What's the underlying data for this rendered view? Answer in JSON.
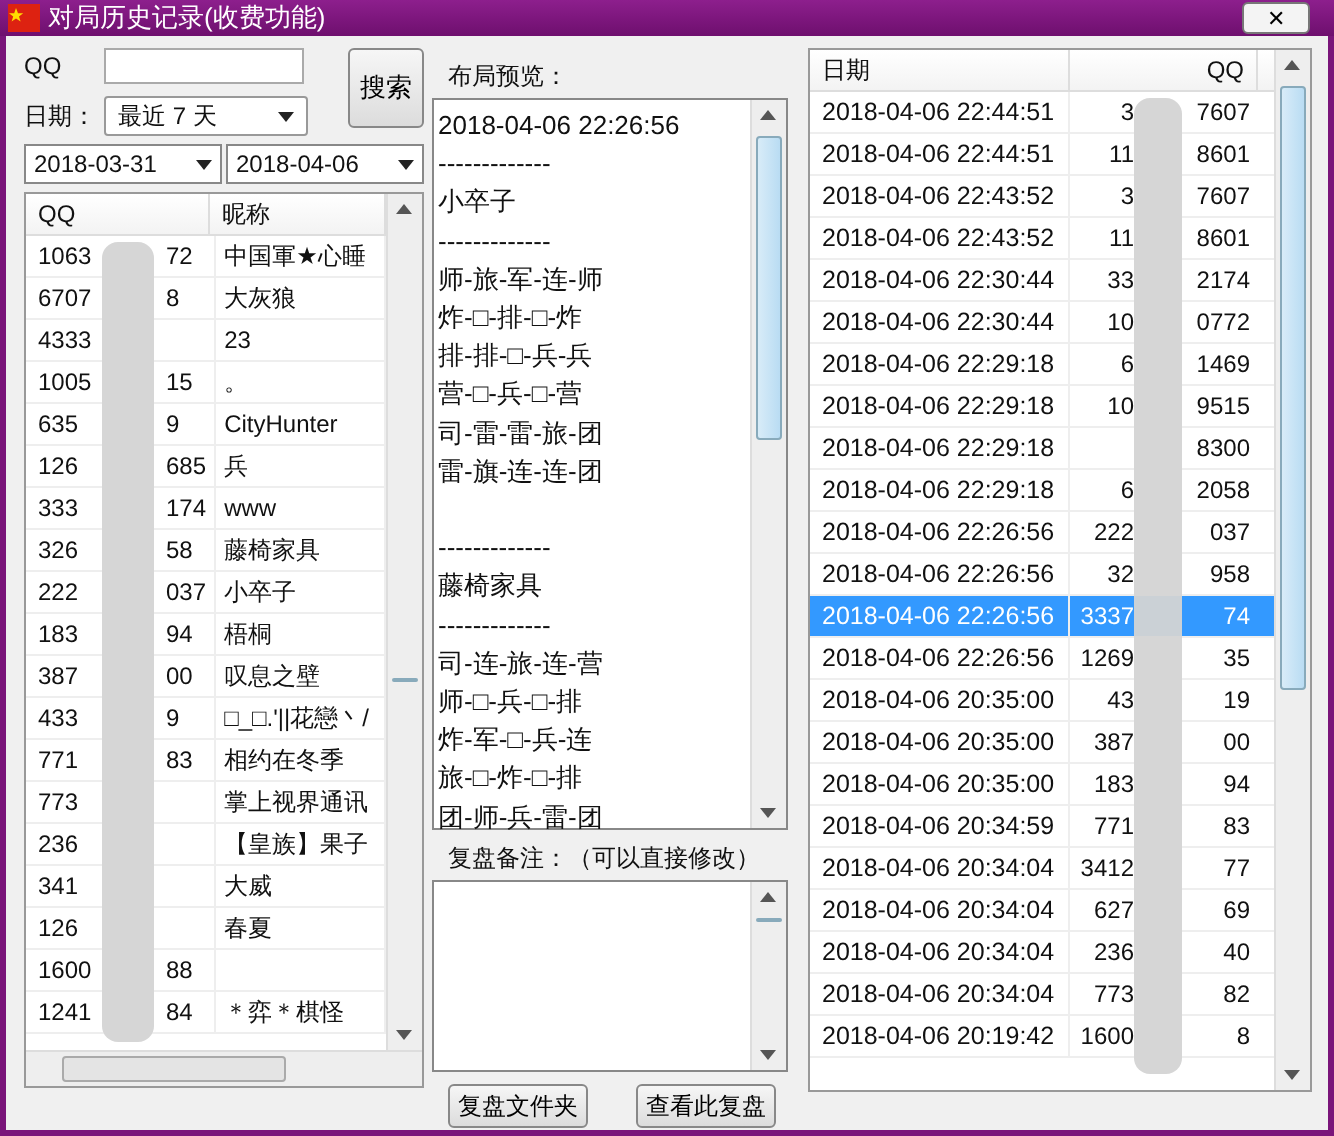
{
  "window": {
    "title": "对局历史记录(收费功能)",
    "close": "✕"
  },
  "search": {
    "qq_label": "QQ",
    "date_label": "日期：",
    "date_range": "最近 7 天",
    "start_date": "2018-03-31",
    "end_date": "2018-04-06",
    "button": "搜索"
  },
  "players": {
    "columns": [
      "QQ",
      "昵称"
    ],
    "rows": [
      {
        "qq_start": "1063",
        "qq_end": "72",
        "nickname": "中国軍★心睡"
      },
      {
        "qq_start": "6707",
        "qq_end": "8",
        "nickname": "大灰狼"
      },
      {
        "qq_start": "4333",
        "nickname": "23"
      },
      {
        "qq_start": "1005",
        "qq_end": "15",
        "nickname": "。"
      },
      {
        "qq_start": "635",
        "qq_end": "9",
        "nickname": "CityHunter"
      },
      {
        "qq_start": "126",
        "qq_end": "685",
        "nickname": "兵"
      },
      {
        "qq_start": "333",
        "qq_end": "174",
        "nickname": "www"
      },
      {
        "qq_start": "326",
        "qq_end": "58",
        "nickname": "藤椅家具"
      },
      {
        "qq_start": "222",
        "qq_end": "037",
        "nickname": "小卒子"
      },
      {
        "qq_start": "183",
        "qq_end": "94",
        "nickname": "梧桐"
      },
      {
        "qq_start": "387",
        "qq_end": "00",
        "nickname": "叹息之壁"
      },
      {
        "qq_start": "433",
        "qq_end": "9",
        "nickname": "□_□.'||花戀丶/"
      },
      {
        "qq_start": "771",
        "qq_end": "83",
        "nickname": "相约在冬季"
      },
      {
        "qq_start": "773",
        "nickname": "掌上视界通讯"
      },
      {
        "qq_start": "236",
        "nickname": "【皇族】果子"
      },
      {
        "qq_start": "341",
        "nickname": "大威"
      },
      {
        "qq_start": "126",
        "nickname": "春夏"
      },
      {
        "qq_start": "1600",
        "qq_end": "88"
      },
      {
        "qq_start": "1241",
        "qq_end": "84",
        "nickname": "＊弈＊棋怪"
      }
    ]
  },
  "preview": {
    "label": "布局预览：",
    "lines": [
      {
        "text": "2018-04-06 22:26:56",
        "gap_before": false
      },
      {
        "text": "-------------",
        "gap_before": false
      },
      {
        "text": "小卒子",
        "gap_before": false
      },
      {
        "text": "-------------",
        "gap_before": false
      },
      {
        "text": "师-旅-军-连-师",
        "gap_before": false
      },
      {
        "text": "炸-□-排-□-炸",
        "gap_before": false
      },
      {
        "text": "排-排-□-兵-兵",
        "gap_before": false
      },
      {
        "text": "营-□-兵-□-营",
        "gap_before": false
      },
      {
        "text": "司-雷-雷-旅-团",
        "gap_before": false
      },
      {
        "text": "雷-旗-连-连-团",
        "gap_before": false
      },
      {
        "text": "-------------",
        "gap_before": true
      },
      {
        "text": "藤椅家具",
        "gap_before": false
      },
      {
        "text": "-------------",
        "gap_before": false
      },
      {
        "text": "司-连-旅-连-营",
        "gap_before": false
      },
      {
        "text": "师-□-兵-□-排",
        "gap_before": false
      },
      {
        "text": "炸-军-□-兵-连",
        "gap_before": false
      },
      {
        "text": "旅-□-炸-□-排",
        "gap_before": false
      },
      {
        "text": "团-师-兵-雷-团",
        "gap_before": false
      }
    ]
  },
  "notes": {
    "label": "复盘备注：（可以直接修改）"
  },
  "buttons": [
    "复盘文件夹",
    "查看此复盘"
  ],
  "games": {
    "columns": [
      "日期",
      "QQ"
    ],
    "rows": [
      {
        "date": "2018-04-06 22:44:51",
        "qq_start": "3",
        "qq_end": "7607",
        "selected": false
      },
      {
        "date": "2018-04-06 22:44:51",
        "qq_start": "11",
        "qq_end": "8601",
        "selected": false
      },
      {
        "date": "2018-04-06 22:43:52",
        "qq_start": "3",
        "qq_end": "7607",
        "selected": false
      },
      {
        "date": "2018-04-06 22:43:52",
        "qq_start": "11",
        "qq_end": "8601",
        "selected": false
      },
      {
        "date": "2018-04-06 22:30:44",
        "qq_start": "33",
        "qq_end": "2174",
        "selected": false
      },
      {
        "date": "2018-04-06 22:30:44",
        "qq_start": "10",
        "qq_end": "0772",
        "selected": false
      },
      {
        "date": "2018-04-06 22:29:18",
        "qq_start": "6",
        "qq_end": "1469",
        "selected": false
      },
      {
        "date": "2018-04-06 22:29:18",
        "qq_start": "10",
        "qq_end": "9515",
        "selected": false
      },
      {
        "date": "2018-04-06 22:29:18",
        "qq_end": "8300",
        "selected": false
      },
      {
        "date": "2018-04-06 22:29:18",
        "qq_start": "6",
        "qq_end": "2058",
        "selected": false
      },
      {
        "date": "2018-04-06 22:26:56",
        "qq_start": "222",
        "qq_end": "037",
        "selected": false
      },
      {
        "date": "2018-04-06 22:26:56",
        "qq_start": "32",
        "qq_end": "958",
        "selected": false
      },
      {
        "date": "2018-04-06 22:26:56",
        "qq_start": "3337",
        "qq_end": "74",
        "selected": true
      },
      {
        "date": "2018-04-06 22:26:56",
        "qq_start": "1269",
        "qq_end": "35",
        "selected": false
      },
      {
        "date": "2018-04-06 20:35:00",
        "qq_start": "43",
        "qq_end": "19",
        "selected": false
      },
      {
        "date": "2018-04-06 20:35:00",
        "qq_start": "387",
        "qq_end": "00",
        "selected": false
      },
      {
        "date": "2018-04-06 20:35:00",
        "qq_start": "183",
        "qq_end": "94",
        "selected": false
      },
      {
        "date": "2018-04-06 20:34:59",
        "qq_start": "771",
        "qq_end": "83",
        "selected": false
      },
      {
        "date": "2018-04-06 20:34:04",
        "qq_start": "3412",
        "qq_end": "77",
        "selected": false
      },
      {
        "date": "2018-04-06 20:34:04",
        "qq_start": "627",
        "qq_end": "69",
        "selected": false
      },
      {
        "date": "2018-04-06 20:34:04",
        "qq_start": "236",
        "qq_end": "40",
        "selected": false
      },
      {
        "date": "2018-04-06 20:34:04",
        "qq_start": "773",
        "qq_end": "82",
        "selected": false
      },
      {
        "date": "2018-04-06 20:19:42",
        "qq_start": "1600",
        "qq_end": "8",
        "selected": false
      }
    ]
  }
}
